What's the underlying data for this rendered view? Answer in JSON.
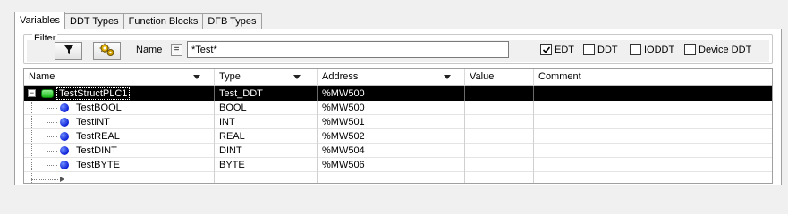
{
  "tabs": [
    {
      "label": "Variables",
      "active": true
    },
    {
      "label": "DDT Types",
      "active": false
    },
    {
      "label": "Function Blocks",
      "active": false
    },
    {
      "label": "DFB Types",
      "active": false
    }
  ],
  "filter": {
    "label": "Filter",
    "funnel_icon": "funnel-icon",
    "settings_icon": "gears-icon",
    "name_label": "Name",
    "equals_label": "=",
    "name_value": "*Test*",
    "checkboxes": [
      {
        "label": "EDT",
        "checked": true
      },
      {
        "label": "DDT",
        "checked": false
      },
      {
        "label": "IODDT",
        "checked": false
      },
      {
        "label": "Device DDT",
        "checked": false
      }
    ]
  },
  "grid": {
    "columns": [
      "Name",
      "Type",
      "Address",
      "Value",
      "Comment"
    ],
    "root": {
      "name": "TestStructPLC1",
      "type": "Test_DDT",
      "address": "%MW500",
      "value": "",
      "comment": ""
    },
    "children": [
      {
        "name": "TestBOOL",
        "type": "BOOL",
        "address": "%MW500",
        "value": "",
        "comment": ""
      },
      {
        "name": "TestINT",
        "type": "INT",
        "address": "%MW501",
        "value": "",
        "comment": ""
      },
      {
        "name": "TestREAL",
        "type": "REAL",
        "address": "%MW502",
        "value": "",
        "comment": ""
      },
      {
        "name": "TestDINT",
        "type": "DINT",
        "address": "%MW504",
        "value": "",
        "comment": ""
      },
      {
        "name": "TestBYTE",
        "type": "BYTE",
        "address": "%MW506",
        "value": "",
        "comment": ""
      }
    ],
    "expander_symbol": "−"
  },
  "colors": {
    "selected_row": "#000000",
    "struct_icon": "#16b816",
    "element_dot": "#0b1fd6"
  }
}
